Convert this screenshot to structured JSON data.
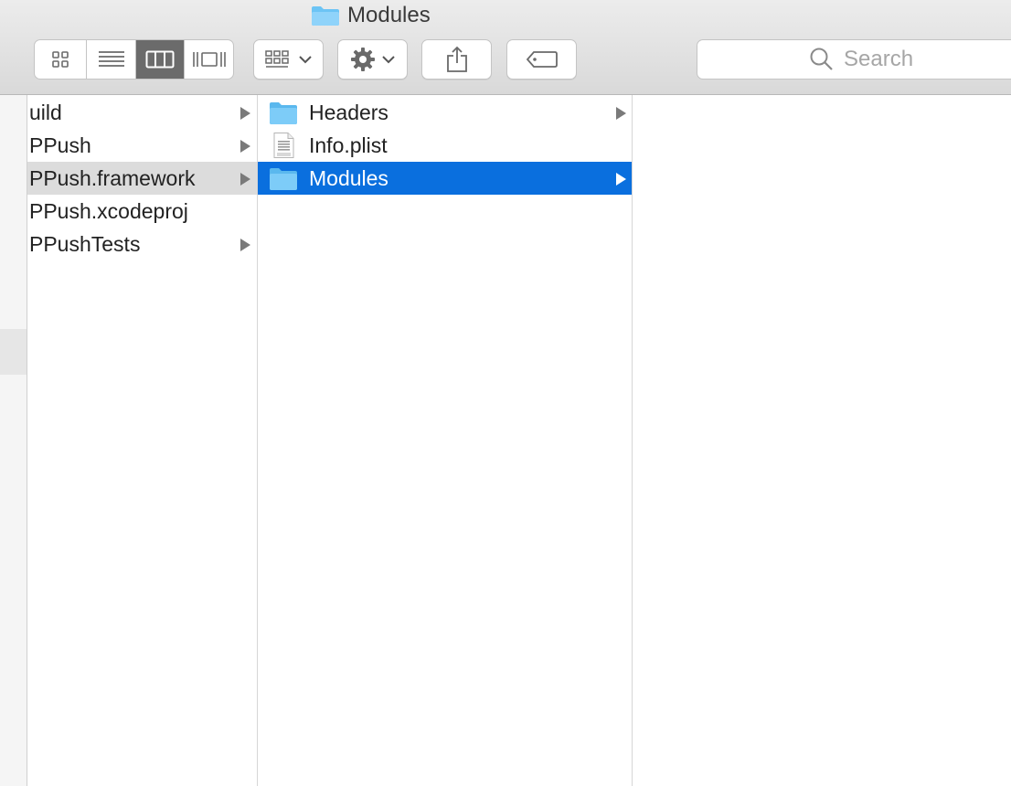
{
  "window": {
    "title": "Modules"
  },
  "toolbar": {
    "view_modes": [
      {
        "name": "icon-view",
        "icon": "grid-icon",
        "active": false
      },
      {
        "name": "list-view",
        "icon": "list-icon",
        "active": false
      },
      {
        "name": "column-view",
        "icon": "columns-icon",
        "active": true
      },
      {
        "name": "coverflow-view",
        "icon": "coverflow-icon",
        "active": false
      }
    ],
    "arrange_icon": "arrange-icon",
    "action_icon": "gear-icon",
    "share_icon": "share-icon",
    "tag_icon": "tag-icon",
    "search_placeholder": "Search"
  },
  "columns": {
    "col1": [
      {
        "label": "uild",
        "has_children": true,
        "state": "none"
      },
      {
        "label": "PPush",
        "has_children": true,
        "state": "none"
      },
      {
        "label": "PPush.framework",
        "has_children": true,
        "state": "inactive-selected"
      },
      {
        "label": "PPush.xcodeproj",
        "has_children": false,
        "state": "none"
      },
      {
        "label": "PPushTests",
        "has_children": true,
        "state": "none"
      }
    ],
    "col2": [
      {
        "label": "Headers",
        "icon": "folder-icon",
        "has_children": true,
        "state": "none"
      },
      {
        "label": "Info.plist",
        "icon": "plist-file-icon",
        "has_children": false,
        "state": "none"
      },
      {
        "label": "Modules",
        "icon": "folder-icon",
        "has_children": true,
        "state": "selected"
      }
    ],
    "col3": []
  },
  "colors": {
    "selection": "#0a6fde",
    "inactive_selection": "#dcdcdc",
    "folder": "#6cc4f5",
    "active_segment": "#6b6b6b"
  }
}
